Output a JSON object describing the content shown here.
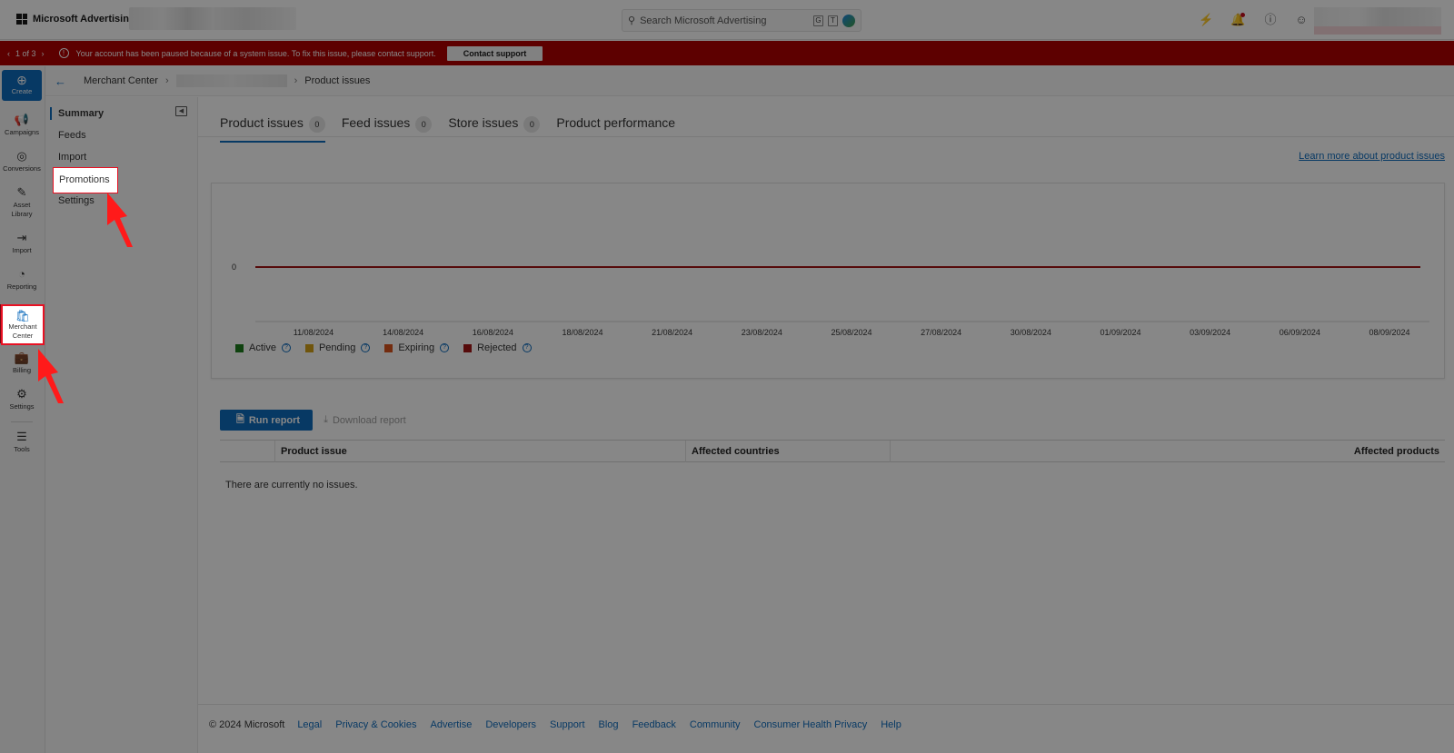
{
  "topbar": {
    "app_title": "Microsoft Advertising",
    "search_placeholder": "Search Microsoft Advertising",
    "kbd_keys": [
      "G",
      "T"
    ]
  },
  "banner": {
    "pager": "1 of 3",
    "message": "Your account has been paused because of a system issue. To fix this issue, please contact support.",
    "button": "Contact support",
    "color": "#b00000"
  },
  "rail": {
    "create": "Create",
    "items": [
      {
        "label": "Campaigns",
        "icon": "megaphone-icon"
      },
      {
        "label": "Conversions",
        "icon": "target-icon"
      },
      {
        "label": "Asset Library",
        "icon": "image-edit-icon"
      },
      {
        "label": "Import",
        "icon": "arrow-import-icon"
      },
      {
        "label": "Reporting",
        "icon": "chart-pie-icon"
      },
      {
        "label": "Merchant Center",
        "icon": "shopping-bag-icon"
      },
      {
        "label": "Billing",
        "icon": "wallet-icon"
      },
      {
        "label": "Settings",
        "icon": "gear-icon"
      },
      {
        "label": "Tools",
        "icon": "tools-list-icon"
      }
    ]
  },
  "breadcrumb": {
    "root": "Merchant Center",
    "current": "Product issues"
  },
  "subnav": {
    "items": [
      "Summary",
      "Feeds",
      "Import",
      "Promotions",
      "Settings"
    ]
  },
  "tabs": [
    {
      "label": "Product issues",
      "count": "0"
    },
    {
      "label": "Feed issues",
      "count": "0"
    },
    {
      "label": "Store issues",
      "count": "0"
    },
    {
      "label": "Product performance"
    }
  ],
  "learn_more": "Learn more about product issues",
  "chart_data": {
    "type": "line",
    "x": [
      "11/08/2024",
      "14/08/2024",
      "16/08/2024",
      "18/08/2024",
      "21/08/2024",
      "23/08/2024",
      "25/08/2024",
      "27/08/2024",
      "30/08/2024",
      "01/09/2024",
      "03/09/2024",
      "06/09/2024",
      "08/09/2024"
    ],
    "y_ticks": [
      "0"
    ],
    "series": [
      {
        "name": "Active",
        "color": "#1e7d1e",
        "values": [
          0,
          0,
          0,
          0,
          0,
          0,
          0,
          0,
          0,
          0,
          0,
          0,
          0
        ]
      },
      {
        "name": "Pending",
        "color": "#d4a017",
        "values": [
          0,
          0,
          0,
          0,
          0,
          0,
          0,
          0,
          0,
          0,
          0,
          0,
          0
        ]
      },
      {
        "name": "Expiring",
        "color": "#d9541e",
        "values": [
          0,
          0,
          0,
          0,
          0,
          0,
          0,
          0,
          0,
          0,
          0,
          0,
          0
        ]
      },
      {
        "name": "Rejected",
        "color": "#a31515",
        "values": [
          0,
          0,
          0,
          0,
          0,
          0,
          0,
          0,
          0,
          0,
          0,
          0,
          0
        ]
      }
    ],
    "ylim": [
      0,
      0
    ],
    "legend": "bottom-left"
  },
  "report": {
    "run": "Run report",
    "download": "Download report"
  },
  "table": {
    "columns": [
      "Product issue",
      "Affected countries",
      "Affected products"
    ],
    "empty": "There are currently no issues."
  },
  "footer": {
    "copyright": "© 2024 Microsoft",
    "links": [
      "Legal",
      "Privacy & Cookies",
      "Advertise",
      "Developers",
      "Support",
      "Blog",
      "Feedback",
      "Community",
      "Consumer Health Privacy",
      "Help"
    ]
  }
}
